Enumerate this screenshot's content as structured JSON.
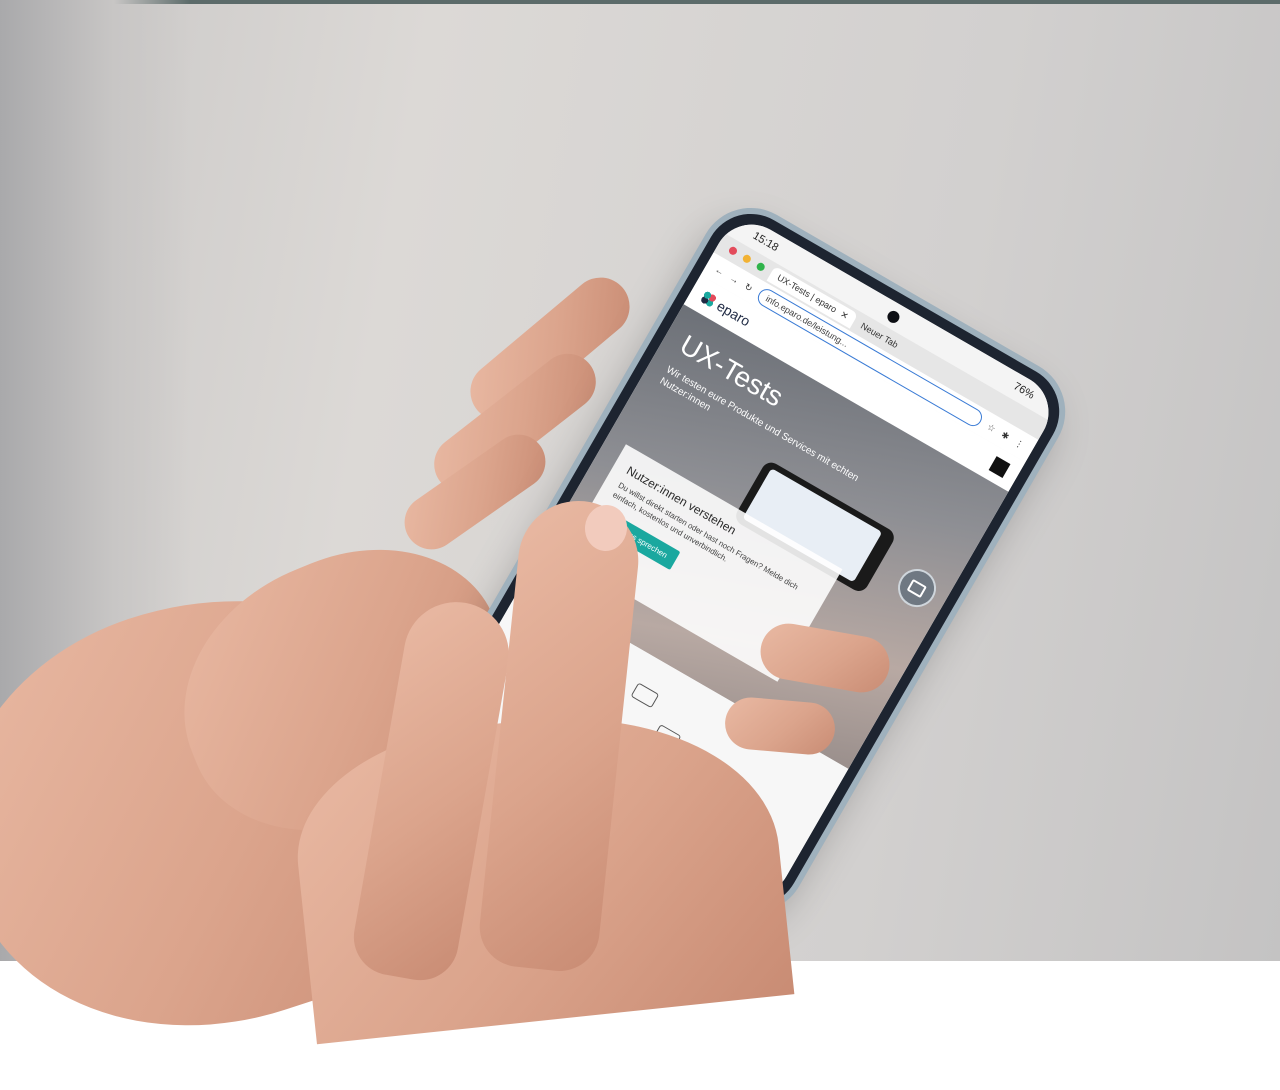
{
  "status_bar": {
    "time": "15:18",
    "battery": "76%"
  },
  "browser": {
    "tab_title": "UX-Tests | eparo",
    "tab_tooltip": "Neuer Tab",
    "url": "info.eparo.de/leistung..."
  },
  "site": {
    "logo_text": "eparo",
    "hero_title": "UX-Tests",
    "hero_subtitle": "Wir testen eure Produkte und Services mit echten Nutzer:innen",
    "card_title": "Nutzer:innen verstehen",
    "card_text": "Du willst direkt starten oder hast noch Fragen? Melde dich einfach, kostenlos und unverbindlich.",
    "cta_label": "Lass uns sprechen"
  },
  "colors": {
    "accent": "#1aa89f",
    "brand_dark": "#1f2a44",
    "phone_frame": "#9fb1bd"
  }
}
